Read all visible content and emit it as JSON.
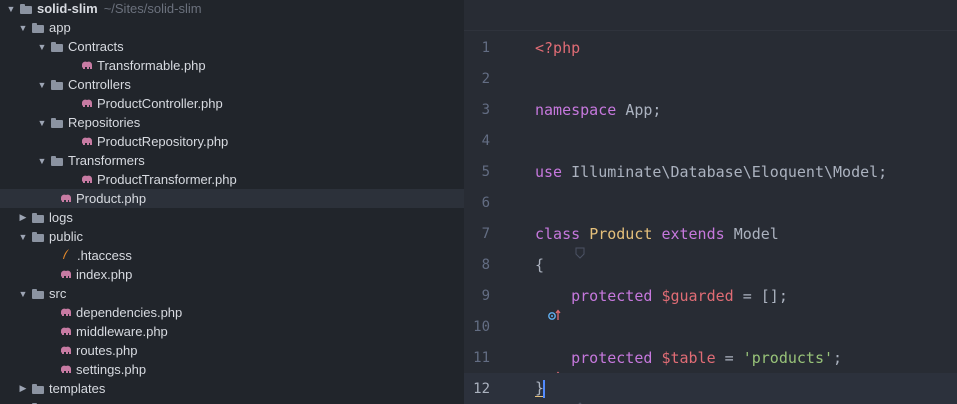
{
  "colors": {
    "sidebar_bg": "#21252b",
    "editor_bg": "#282c34",
    "selection_bg": "#2c313a",
    "keyword": "#c678dd",
    "class_name": "#e5c07b",
    "variable": "#e06c75",
    "string": "#98c379",
    "text": "#abb2bf",
    "php_icon": "#c77ba3",
    "htaccess_icon": "#e5892a"
  },
  "tree": {
    "root_label": "solid-slim",
    "root_path": "~/Sites/solid-slim",
    "items": [
      {
        "label": "app",
        "type": "folder",
        "expanded": true
      },
      {
        "label": "Contracts",
        "type": "folder",
        "expanded": true
      },
      {
        "label": "Transformable.php",
        "type": "php-file"
      },
      {
        "label": "Controllers",
        "type": "folder",
        "expanded": true
      },
      {
        "label": "ProductController.php",
        "type": "php-file"
      },
      {
        "label": "Repositories",
        "type": "folder",
        "expanded": true
      },
      {
        "label": "ProductRepository.php",
        "type": "php-file"
      },
      {
        "label": "Transformers",
        "type": "folder",
        "expanded": true
      },
      {
        "label": "ProductTransformer.php",
        "type": "php-file"
      },
      {
        "label": "Product.php",
        "type": "php-file",
        "selected": true
      },
      {
        "label": "logs",
        "type": "folder",
        "expanded": false
      },
      {
        "label": "public",
        "type": "folder",
        "expanded": true
      },
      {
        "label": ".htaccess",
        "type": "htaccess-file"
      },
      {
        "label": "index.php",
        "type": "php-file"
      },
      {
        "label": "src",
        "type": "folder",
        "expanded": true
      },
      {
        "label": "dependencies.php",
        "type": "php-file"
      },
      {
        "label": "middleware.php",
        "type": "php-file"
      },
      {
        "label": "routes.php",
        "type": "php-file"
      },
      {
        "label": "settings.php",
        "type": "php-file"
      },
      {
        "label": "templates",
        "type": "folder",
        "expanded": false
      }
    ]
  },
  "editor": {
    "line_numbers": [
      "1",
      "2",
      "3",
      "4",
      "5",
      "6",
      "7",
      "8",
      "9",
      "10",
      "11",
      "12"
    ],
    "lines": {
      "l1": {
        "open_tag": "<?php"
      },
      "l3": {
        "keyword": "namespace",
        "name": "App",
        "end": ";"
      },
      "l5": {
        "keyword": "use",
        "path": "Illuminate\\Database\\Eloquent\\Model",
        "end": ";"
      },
      "l7": {
        "keyword": "class",
        "name": "Product",
        "extends": "extends",
        "parent": "Model"
      },
      "l8": {
        "brace": "{"
      },
      "l9": {
        "indent": "    ",
        "keyword": "protected",
        "var": "$guarded",
        "op": " = ",
        "value": "[]",
        "end": ";"
      },
      "l11": {
        "indent": "    ",
        "keyword": "protected",
        "var": "$table",
        "op": " = ",
        "value": "'products'",
        "end": ";"
      },
      "l12": {
        "brace": "}"
      }
    }
  }
}
